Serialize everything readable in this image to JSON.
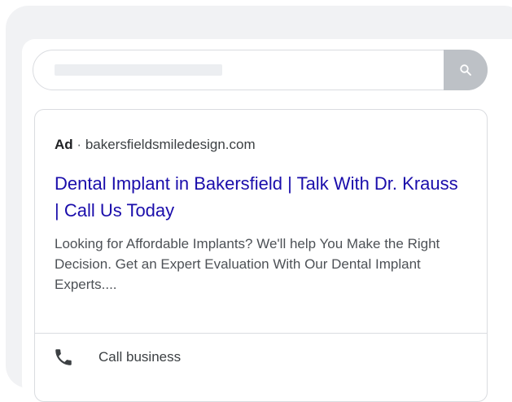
{
  "search": {
    "button_icon": "search-icon"
  },
  "ad": {
    "badge": "Ad",
    "separator": "·",
    "domain": "bakersfieldsmiledesign.com",
    "title": "Dental Implant in Bakersfield | Talk With Dr. Krauss | Call Us Today",
    "description": "Looking for Affordable Implants? We'll help You Make the Right Decision. Get an Expert Evaluation With Our Dental Implant Experts....",
    "call_label": "Call business",
    "call_icon": "phone-icon"
  },
  "colors": {
    "title_link": "#1a0dab",
    "search_button": "#bdc1c6",
    "background": "#f1f2f4"
  }
}
